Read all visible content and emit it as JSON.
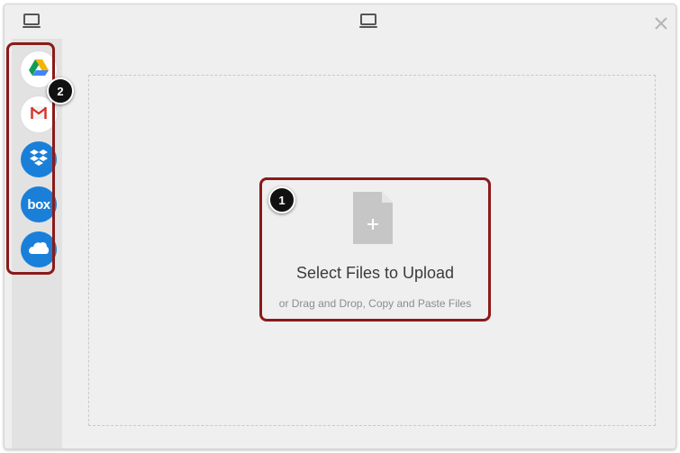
{
  "header": {
    "left_icon": "laptop-icon",
    "center_icon": "laptop-icon",
    "close_icon": "close-icon"
  },
  "sidebar": {
    "items": [
      {
        "icon": "google-drive-icon",
        "label": ""
      },
      {
        "icon": "gmail-icon",
        "label": ""
      },
      {
        "icon": "dropbox-icon",
        "label": ""
      },
      {
        "icon": "box-icon",
        "label": "box"
      },
      {
        "icon": "onedrive-icon",
        "label": ""
      }
    ]
  },
  "callouts": {
    "one": "1",
    "two": "2"
  },
  "upload": {
    "title": "Select Files to Upload",
    "subtitle": "or Drag and Drop, Copy and Paste Files",
    "icon": "file-add-icon"
  },
  "colors": {
    "highlight": "#8b1a1a",
    "source_blue": "#1a7fd9",
    "background": "#efefef"
  }
}
